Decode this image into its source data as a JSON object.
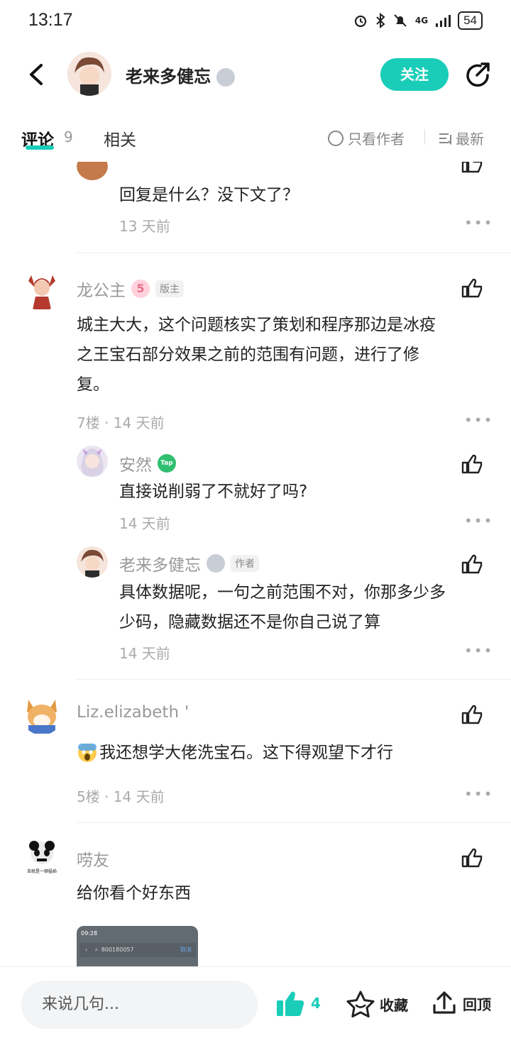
{
  "status_bar": {
    "time": "13:17",
    "network": "4G",
    "battery": "54"
  },
  "header": {
    "title": "老来多健忘",
    "badge": "T",
    "follow_label": "关注"
  },
  "tabs": {
    "comments_label": "评论",
    "comments_count": "9",
    "related_label": "相关",
    "only_author_label": "只看作者",
    "sort_label": "最新"
  },
  "comments": [
    {
      "reply_text": "回复是什么？没下文了？",
      "time": "13 天前"
    },
    {
      "username": "龙公主",
      "level_badge": "5",
      "role_tag": "版主",
      "text_lines": [
        "城主大大，这个问题核实了策划和程序那边是冰疫",
        "之王宝石部分效果之前的范围有问题，进行了修",
        "复。"
      ],
      "meta": "7楼 · 14 天前",
      "replies": [
        {
          "username": "安然",
          "badge": "Tap",
          "text": "直接说削弱了不就好了吗?",
          "time": "14 天前"
        },
        {
          "username": "老来多健忘",
          "badge": "T",
          "tag": "作者",
          "text_lines": [
            "具体数据呢，一句之前范围不对，你那多少多",
            "少码，隐藏数据还不是你自己说了算"
          ],
          "time": "14 天前"
        }
      ]
    },
    {
      "username": "Liz.elizabeth",
      "username_suffix": "'",
      "text": "我还想学大佬洗宝石。这下得观望下才行",
      "meta": "5楼 · 14 天前"
    },
    {
      "username": "唠友",
      "avatar_caption": "去就是一顿猛掐",
      "text": "给你看个好东西",
      "screenshot": {
        "time": "09:28",
        "query": "800180057",
        "cancel": "取消"
      }
    }
  ],
  "bottom_bar": {
    "input_placeholder": "来说几句...",
    "like_count": "4",
    "favorite_label": "收藏",
    "top_label": "回顶"
  },
  "colors": {
    "accent": "#19cdb8",
    "text": "#222222",
    "muted": "#999999"
  }
}
